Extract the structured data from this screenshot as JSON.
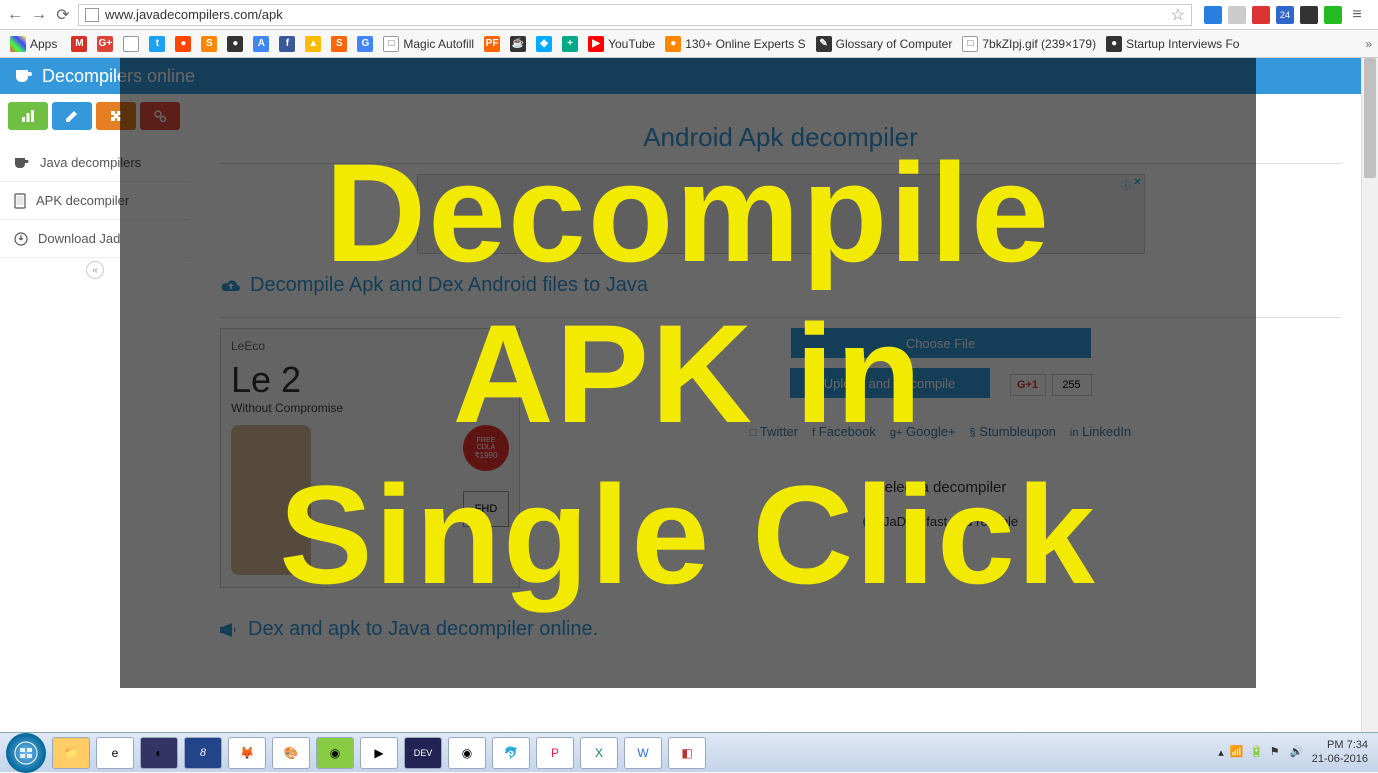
{
  "browser": {
    "url": "www.javadecompilers.com/apk"
  },
  "bookmarks_bar": {
    "apps": "Apps",
    "items": [
      {
        "label": "",
        "color": "#d93025",
        "initial": "M"
      },
      {
        "label": "",
        "color": "#db4437",
        "initial": "G+"
      },
      {
        "label": "",
        "color": "#fff",
        "initial": ""
      },
      {
        "label": "",
        "color": "#1da1f2",
        "initial": "t"
      },
      {
        "label": "",
        "color": "#ff4500",
        "initial": "●"
      },
      {
        "label": "",
        "color": "#f80",
        "initial": "S"
      },
      {
        "label": "",
        "color": "#333",
        "initial": "●"
      },
      {
        "label": "",
        "color": "#4285f4",
        "initial": "A"
      },
      {
        "label": "",
        "color": "#3b5998",
        "initial": "f"
      },
      {
        "label": "",
        "color": "#fbbc05",
        "initial": "▲"
      },
      {
        "label": "",
        "color": "#f60",
        "initial": "S"
      },
      {
        "label": "",
        "color": "#4285f4",
        "initial": "G"
      },
      {
        "label": "Magic Autofill",
        "color": "#fff",
        "initial": "□"
      },
      {
        "label": "",
        "color": "#f60",
        "initial": "PF"
      },
      {
        "label": "",
        "color": "#333",
        "initial": "☕"
      },
      {
        "label": "",
        "color": "#0af",
        "initial": "◆"
      },
      {
        "label": "",
        "color": "#0a8",
        "initial": "+"
      },
      {
        "label": "YouTube",
        "color": "#f00",
        "initial": "▶"
      },
      {
        "label": "130+ Online Experts S",
        "color": "#f80",
        "initial": "●"
      },
      {
        "label": "Glossary of Computer",
        "color": "#333",
        "initial": "✎"
      },
      {
        "label": "7bkZIpj.gif (239×179)",
        "color": "#fff",
        "initial": "□"
      },
      {
        "label": "Startup Interviews Fo",
        "color": "#333",
        "initial": "●"
      }
    ]
  },
  "brand": "Decompilers online",
  "toolbar_colors": [
    "#6fbf44",
    "#3498db",
    "#e67e22",
    "#e74c3c"
  ],
  "sidebar": {
    "items": [
      {
        "label": "Java decompilers"
      },
      {
        "label": "APK decompiler"
      },
      {
        "label": "Download Jad"
      }
    ]
  },
  "content": {
    "page_title": "Android Apk decompiler",
    "upload_heading": "Decompile Apk and Dex Android files to Java",
    "side_ad": {
      "brand": "LeEco",
      "model": "Le 2",
      "tag": "Without Compromise",
      "badge_top": "FREE",
      "badge_mid": "CDLA",
      "badge_price": "₹1990",
      "fhd": "FHD"
    },
    "choose_label": "Choose File",
    "upload_label": "Upload and Decompile",
    "gplus": "G+1",
    "gplus_count": "255",
    "socials": [
      "Twitter",
      "Facebook",
      "Google+",
      "Stumbleupon",
      "LinkedIn"
    ],
    "select_label": "Select a decompiler",
    "radio_label": "JaDX - fast and reliable",
    "lower_heading": "Dex and apk to Java decompiler online."
  },
  "overlay": {
    "line1": "Decompile",
    "line2": "APK in",
    "line3": "Single Click"
  },
  "taskbar": {
    "time": "PM 7:34",
    "date": "21-06-2016"
  }
}
